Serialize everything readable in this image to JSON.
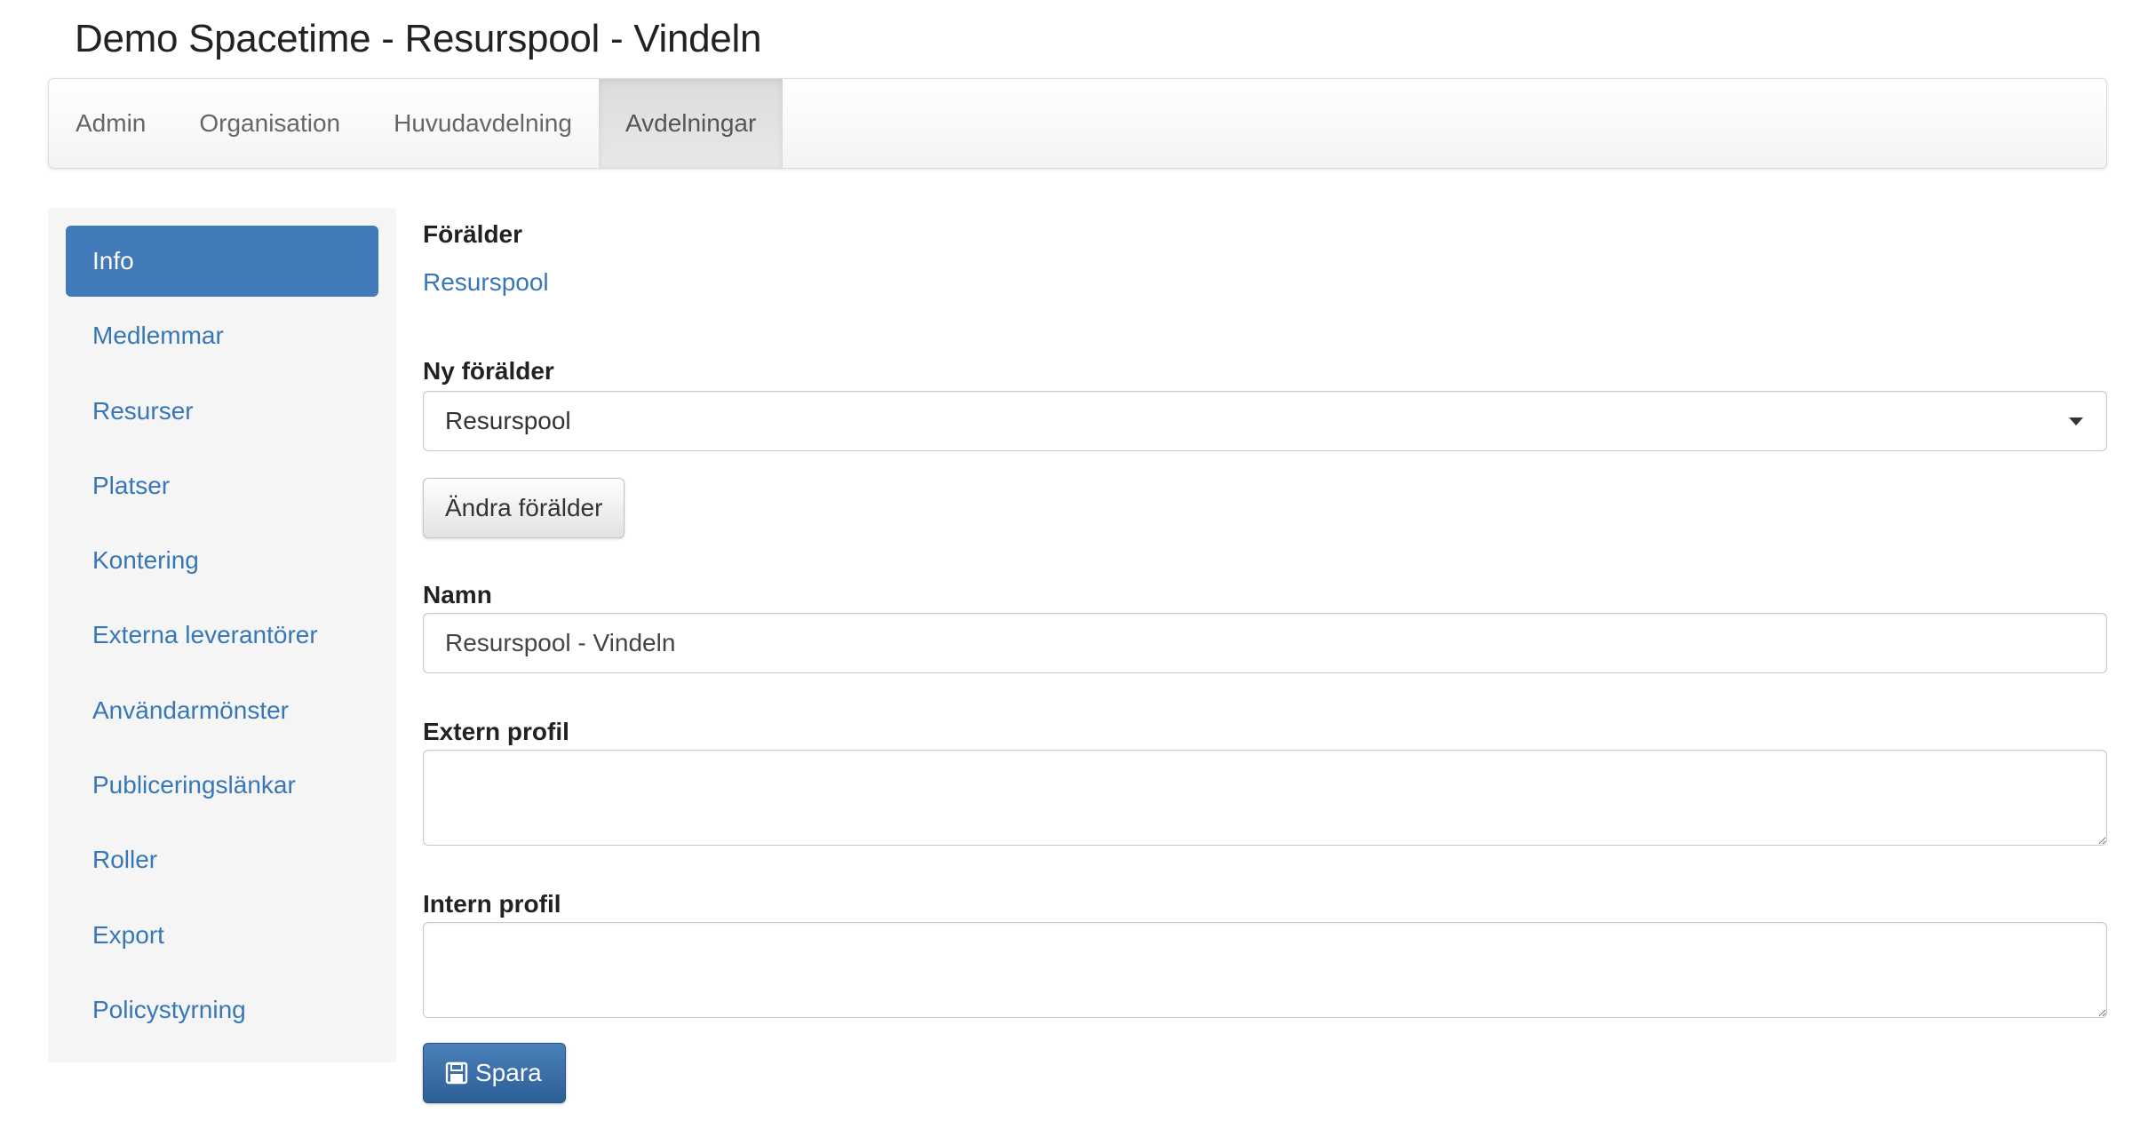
{
  "page": {
    "title": "Demo Spacetime - Resurspool - Vindeln"
  },
  "topnav": {
    "items": [
      {
        "label": "Admin"
      },
      {
        "label": "Organisation"
      },
      {
        "label": "Huvudavdelning"
      },
      {
        "label": "Avdelningar",
        "active": true
      }
    ]
  },
  "sidebar": {
    "items": [
      {
        "label": "Info",
        "active": true
      },
      {
        "label": "Medlemmar"
      },
      {
        "label": "Resurser"
      },
      {
        "label": "Platser"
      },
      {
        "label": "Kontering"
      },
      {
        "label": "Externa leverantörer"
      },
      {
        "label": "Användarmönster"
      },
      {
        "label": "Publiceringslänkar"
      },
      {
        "label": "Roller"
      },
      {
        "label": "Export"
      },
      {
        "label": "Policystyrning"
      }
    ]
  },
  "form": {
    "parent_label": "Förälder",
    "parent_value": "Resurspool",
    "new_parent_label": "Ny förälder",
    "new_parent_selected": "Resurspool",
    "change_parent_button": "Ändra förälder",
    "name_label": "Namn",
    "name_value": "Resurspool - Vindeln",
    "external_profile_label": "Extern profil",
    "external_profile_value": "",
    "internal_profile_label": "Intern profil",
    "internal_profile_value": "",
    "save_button": "Spara"
  },
  "icons": {
    "save": "floppy-disk-icon",
    "dropdown": "caret-down-icon"
  },
  "colors": {
    "link": "#3777b7",
    "active_sidebar": "#4279b9",
    "primary_button": "#2d5f97"
  }
}
